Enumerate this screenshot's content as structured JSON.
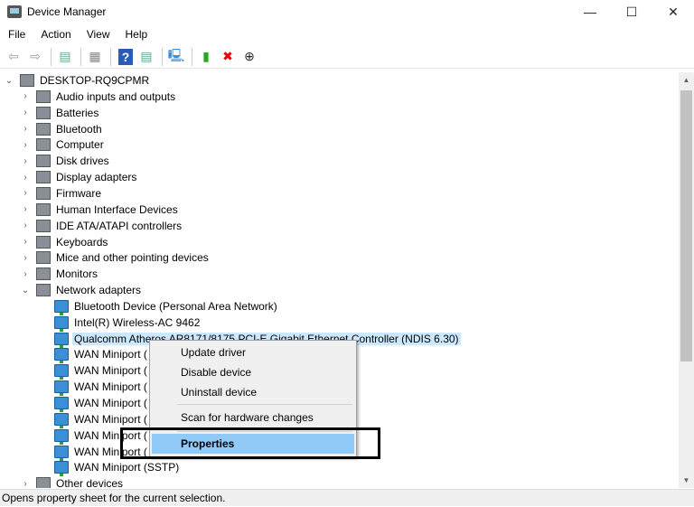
{
  "window": {
    "title": "Device Manager",
    "minimize": "—",
    "maximize": "☐",
    "close": "✕"
  },
  "menu": [
    "File",
    "Action",
    "View",
    "Help"
  ],
  "toolbar": [
    {
      "name": "back-icon",
      "glyph": "⇦",
      "color": "#999"
    },
    {
      "name": "forward-icon",
      "glyph": "⇨",
      "color": "#999"
    },
    {
      "sep": true
    },
    {
      "name": "show-hide-console-tree-icon",
      "glyph": "▤",
      "color": "#6a8"
    },
    {
      "sep": true
    },
    {
      "name": "properties-icon",
      "glyph": "▦",
      "color": "#888"
    },
    {
      "sep": true
    },
    {
      "name": "help-icon",
      "glyph": "?",
      "color": "#fff",
      "bg": "#2a5bb8"
    },
    {
      "name": "show-action-pane-icon",
      "glyph": "▤",
      "color": "#6a8"
    },
    {
      "sep": true
    },
    {
      "name": "scan-hardware-icon",
      "glyph": "🖳",
      "color": "#3a8fd6"
    },
    {
      "sep": true
    },
    {
      "name": "update-driver-icon",
      "glyph": "▮",
      "color": "#2a2"
    },
    {
      "name": "uninstall-icon",
      "glyph": "✖",
      "color": "#e00"
    },
    {
      "name": "download-icon",
      "glyph": "⊕",
      "color": "#222"
    }
  ],
  "tree": {
    "root": "DESKTOP-RQ9CPMR",
    "categories": [
      "Audio inputs and outputs",
      "Batteries",
      "Bluetooth",
      "Computer",
      "Disk drives",
      "Display adapters",
      "Firmware",
      "Human Interface Devices",
      "IDE ATA/ATAPI controllers",
      "Keyboards",
      "Mice and other pointing devices",
      "Monitors",
      "Network adapters"
    ],
    "network_children": [
      "Bluetooth Device (Personal Area Network)",
      "Intel(R) Wireless-AC 9462",
      "Qualcomm Atheros AR8171/8175 PCI-E Gigabit Ethernet Controller (NDIS 6.30)",
      "WAN Miniport (",
      "WAN Miniport (",
      "WAN Miniport (",
      "WAN Miniport (",
      "WAN Miniport (",
      "WAN Miniport (",
      "WAN Miniport (",
      "WAN Miniport (SSTP)"
    ],
    "after": "Other devices",
    "selected_index": 2
  },
  "context_menu": {
    "items": [
      "Update driver",
      "Disable device",
      "Uninstall device",
      "Scan for hardware changes",
      "Properties"
    ],
    "highlighted": "Properties"
  },
  "status": "Opens property sheet for the current selection."
}
